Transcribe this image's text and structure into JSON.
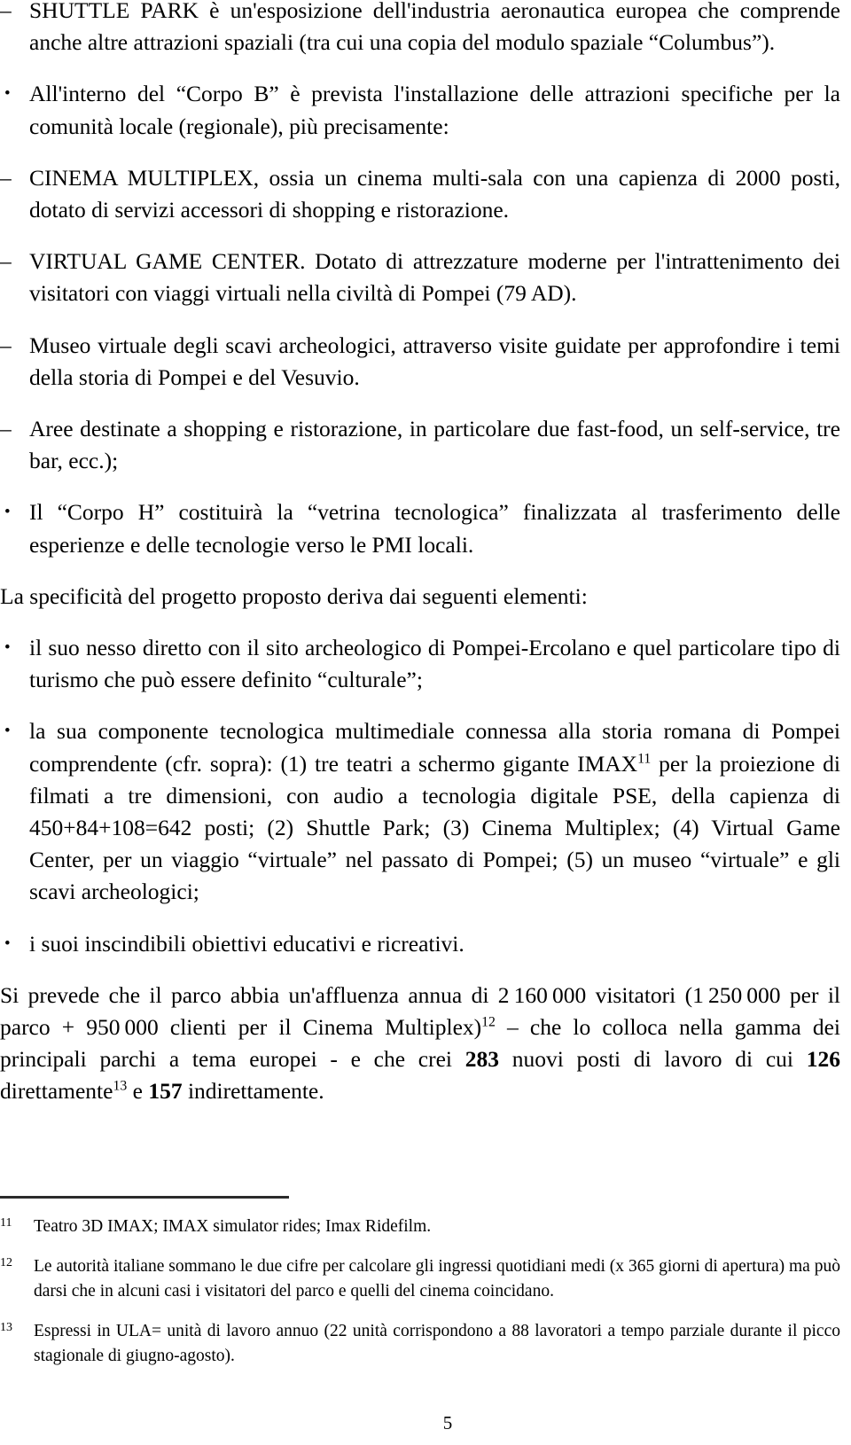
{
  "document": {
    "page_number": "5",
    "blocks": [
      {
        "id": "shuttle-park",
        "marker": "–",
        "text": "SHUTTLE PARK è un'esposizione dell'industria aeronautica europea che comprende anche altre attrazioni spaziali (tra cui una copia del modulo spaziale “Columbus”)."
      },
      {
        "id": "corpo-b",
        "marker": "•",
        "text": "All'interno del “Corpo B” è prevista l'installazione delle attrazioni specifiche per la comunità locale (regionale), più precisamente:"
      },
      {
        "id": "cinema-multiplex",
        "marker": "–",
        "text": "CINEMA MULTIPLEX, ossia un cinema multi-sala con una capienza di 2000 posti, dotato di servizi accessori di shopping e ristorazione."
      },
      {
        "id": "virtual-game-center",
        "marker": "–",
        "text": "VIRTUAL GAME CENTER. Dotato di attrezzature moderne per l'intrattenimento dei visitatori con viaggi virtuali nella civiltà di Pompei (79 AD)."
      },
      {
        "id": "museo-virtuale",
        "marker": "–",
        "text": "Museo virtuale degli scavi archeologici, attraverso visite guidate per approfondire i temi della storia di Pompei e del Vesuvio."
      },
      {
        "id": "aree-shopping",
        "marker": "–",
        "text": "Aree destinate a shopping e ristorazione, in particolare due fast-food, un self-service, tre bar, ecc.);"
      },
      {
        "id": "corpo-h",
        "marker": "•",
        "text": "Il “Corpo H” costituirà la “vetrina tecnologica” finalizzata al trasferimento delle esperienze e delle tecnologie verso le PMI locali."
      },
      {
        "id": "specificita-intro",
        "marker": "",
        "text": "La specificità del progetto proposto deriva dai seguenti elementi:"
      },
      {
        "id": "nesso-diretto",
        "marker": "•",
        "text": "il suo nesso diretto con il sito archeologico di Pompei-Ercolano e quel particolare tipo di turismo che può essere definito “culturale”;"
      },
      {
        "id": "componente-tecnologica",
        "marker": "•",
        "text_before_sup": "la sua componente tecnologica multimediale connessa alla storia romana di Pompei comprendente (cfr. sopra): (1) tre teatri a schermo gigante IMAX",
        "sup": "11",
        "text_after_sup": " per la proiezione di filmati a tre dimensioni, con audio a tecnologia digitale PSE, della capienza di 450+84+108=642 posti; (2) Shuttle Park; (3) Cinema Multiplex; (4) Virtual Game Center, per un viaggio “virtuale” nel passato di Pompei; (5) un museo “virtuale” e gli scavi archeologici;"
      },
      {
        "id": "obiettivi",
        "marker": "•",
        "text": "i suoi inscindibili obiettivi educativi e ricreativi."
      }
    ],
    "closing_paragraph": {
      "id": "affluenza",
      "seg1": "Si prevede che il parco abbia un'affluenza annua di 2 160 000 visitatori (1 250 000 per il parco + 950 000 clienti per il Cinema Multiplex)",
      "sup1": "12",
      "seg2": " – che lo colloca nella gamma dei principali parchi a tema europei - e che crei ",
      "bold1": "283",
      "seg3": " nuovi posti di lavoro di cui ",
      "bold2": "126",
      "seg4": " direttamente",
      "sup2": "13",
      "seg5": " e ",
      "bold3": "157",
      "seg6": " indirettamente."
    },
    "footnotes": [
      {
        "num": "11",
        "text": "Teatro 3D IMAX; IMAX simulator rides; Imax Ridefilm."
      },
      {
        "num": "12",
        "text": "Le autorità italiane sommano le due cifre per calcolare gli ingressi quotidiani medi (x 365 giorni di apertura) ma può darsi che in alcuni casi i visitatori del parco e quelli del cinema coincidano."
      },
      {
        "num": "13",
        "text": "Espressi in ULA= unità di lavoro annuo (22 unità corrispondono a 88 lavoratori a tempo parziale durante il picco stagionale di giugno-agosto)."
      }
    ]
  }
}
